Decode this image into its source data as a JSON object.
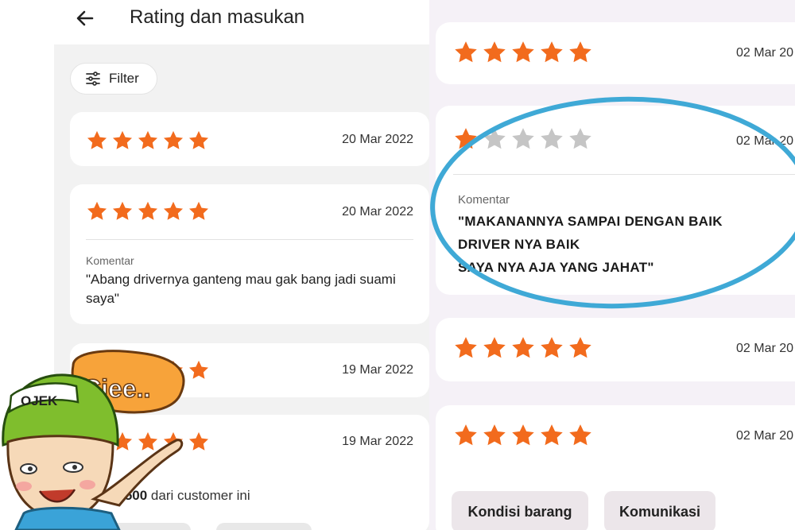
{
  "header": {
    "title": "Rating dan masukan"
  },
  "filter": {
    "label": "Filter"
  },
  "colors": {
    "star_filled": "#f26b1d",
    "star_empty": "#c5c5c5",
    "highlight": "#3fa9d6"
  },
  "left_reviews": [
    {
      "rating": 5,
      "date": "20 Mar 2022"
    },
    {
      "rating": 5,
      "date": "20 Mar 2022",
      "comment_label": "Komentar",
      "comment": "\"Abang drivernya ganteng mau gak bang jadi suami saya\""
    },
    {
      "rating": 5,
      "date": "19 Mar 2022"
    },
    {
      "rating": 5,
      "date": "19 Mar 2022"
    }
  ],
  "tip": {
    "amount": "Rp2.500",
    "suffix": " dari customer ini"
  },
  "sticker": {
    "helmet_text": "OJEK",
    "bubble_text": "Ciee.."
  },
  "right_reviews": [
    {
      "rating": 5,
      "date": "02 Mar 20"
    },
    {
      "rating": 1,
      "date": "02 Mar 20",
      "comment_label": "Komentar",
      "comment_lines": [
        "\"MAKANANNYA SAMPAI DENGAN BAIK",
        "DRIVER NYA BAIK",
        "SAYA NYA AJA YANG JAHAT\""
      ]
    },
    {
      "rating": 5,
      "date": "02 Mar 20"
    },
    {
      "rating": 5,
      "date": "02 Mar 20"
    }
  ],
  "chips": [
    "Kondisi barang",
    "Komunikasi"
  ]
}
